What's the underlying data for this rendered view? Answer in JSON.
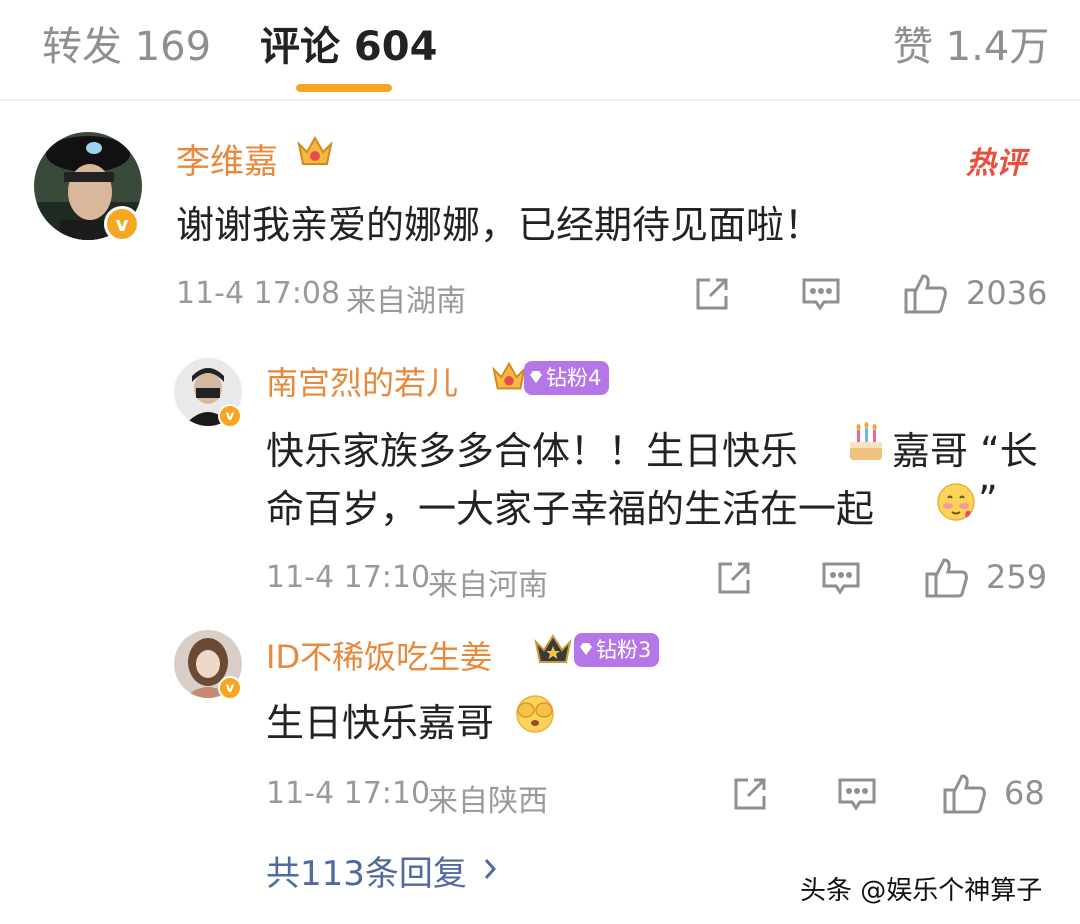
{
  "tabs": [
    {
      "label": "转发 169"
    },
    {
      "label": "评论 604"
    },
    {
      "label": "赞 1.4万"
    }
  ],
  "comment": {
    "username": "李维嘉",
    "text": "谢谢我亲爱的娜娜，已经期待见面啦！",
    "hot_label": "热评",
    "time": "11-4 17:08",
    "location": "来自湖南",
    "likes": "2036"
  },
  "replies": [
    {
      "username": "南宫烈的若儿",
      "fan_badge": "钻粉4",
      "text_line1": "快乐家族多多合体！！生日快乐",
      "text_line1b": "嘉哥 “长",
      "text_line2": "命百岁，一大家子幸福的生活在一起",
      "text_line2b": "”",
      "time": "11-4 17:10",
      "location": "来自河南",
      "likes": "259"
    },
    {
      "username": "ID不稀饭吃生姜",
      "fan_badge": "钻粉3",
      "text": "生日快乐嘉哥",
      "time": "11-4 17:10",
      "location": "来自陕西",
      "likes": "68"
    }
  ],
  "more_replies": "共113条回复",
  "watermark": "头条 @娱乐个神算子",
  "colors": {
    "accent": "#f5a623",
    "username": "#e8883a",
    "hot": "#ea4f3e",
    "link": "#4f6aa1",
    "fan_badge": "#b577e8"
  }
}
